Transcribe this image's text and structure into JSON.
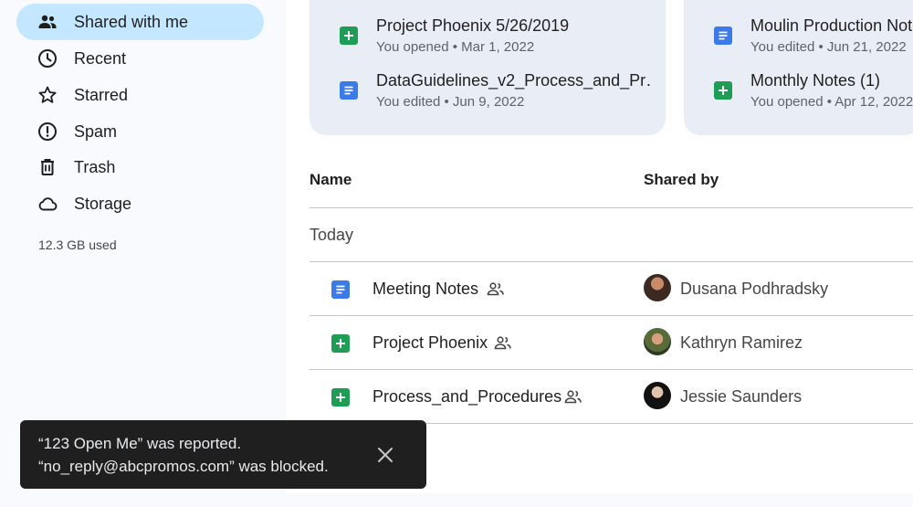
{
  "sidebar": {
    "items": [
      {
        "label": "Shared with me",
        "icon": "people-icon",
        "active": true
      },
      {
        "label": "Recent",
        "icon": "clock-icon"
      },
      {
        "label": "Starred",
        "icon": "star-icon"
      },
      {
        "label": "Spam",
        "icon": "spam-icon"
      },
      {
        "label": "Trash",
        "icon": "trash-icon"
      },
      {
        "label": "Storage",
        "icon": "cloud-icon"
      }
    ],
    "storage_used": "12.3 GB used"
  },
  "suggested": {
    "cards": [
      {
        "files": [
          {
            "title": "Project Phoenix 5/26/2019",
            "subtitle": "You opened • Mar 1, 2022",
            "type": "sheet"
          },
          {
            "title": "DataGuidelines_v2_Process_and_Pr…",
            "subtitle": "You edited • Jun 9, 2022",
            "type": "doc"
          }
        ]
      },
      {
        "files": [
          {
            "title": "Moulin Production Notes",
            "subtitle": "You edited • Jun 21, 2022",
            "type": "doc"
          },
          {
            "title": "Monthly Notes (1)",
            "subtitle": "You opened • Apr 12, 2022",
            "type": "sheet"
          }
        ]
      }
    ]
  },
  "table": {
    "columns": {
      "name": "Name",
      "shared_by": "Shared by"
    },
    "section": "Today",
    "rows": [
      {
        "name": "Meeting Notes",
        "type": "doc",
        "shared_by": "Dusana Podhradsky"
      },
      {
        "name": "Project Phoenix",
        "type": "sheet",
        "shared_by": "Kathryn Ramirez"
      },
      {
        "name": "Process_and_Procedures",
        "type": "sheet",
        "shared_by": "Jessie Saunders"
      }
    ]
  },
  "snackbar": {
    "line1": "“123 Open Me” was reported.",
    "line2": "“no_reply@abcpromos.com” was blocked.",
    "close_icon": "close-icon"
  },
  "colors": {
    "active_nav": "#c2e7ff",
    "doc_blue": "#3b7ae8",
    "sheet_green": "#1f9d55",
    "card_bg": "#e9eef6",
    "snackbar_bg": "#1f1f1f"
  }
}
